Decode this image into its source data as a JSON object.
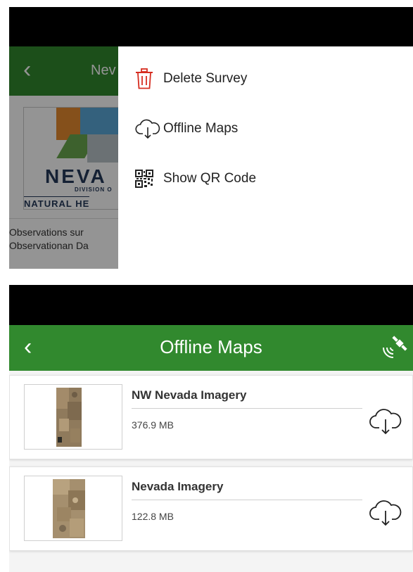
{
  "top_screen": {
    "header": {
      "back_glyph": "‹",
      "title": "Nev"
    },
    "banner": {
      "logo_word": "NEVA",
      "division": "DIVISION O",
      "natural": "NATURAL HE"
    },
    "description_lines": [
      "Observations sur",
      "Observationan Da"
    ],
    "menu": {
      "items": [
        {
          "label": "Delete Survey",
          "icon": "trash-icon",
          "color": "#d62d20"
        },
        {
          "label": "Offline Maps",
          "icon": "cloud-download-icon",
          "color": "#222222"
        },
        {
          "label": "Show QR Code",
          "icon": "qr-code-icon",
          "color": "#222222"
        }
      ]
    }
  },
  "bottom_screen": {
    "header": {
      "back_glyph": "‹",
      "title": "Offline Maps",
      "right_icon": "gps-satellite-icon"
    },
    "maps": [
      {
        "name": "NW Nevada Imagery",
        "size": "376.9 MB",
        "action_icon": "cloud-download-icon"
      },
      {
        "name": "Nevada Imagery",
        "size": "122.8 MB",
        "action_icon": "cloud-download-icon"
      }
    ]
  },
  "colors": {
    "header_green": "#31892e",
    "delete_red": "#d62d20"
  }
}
